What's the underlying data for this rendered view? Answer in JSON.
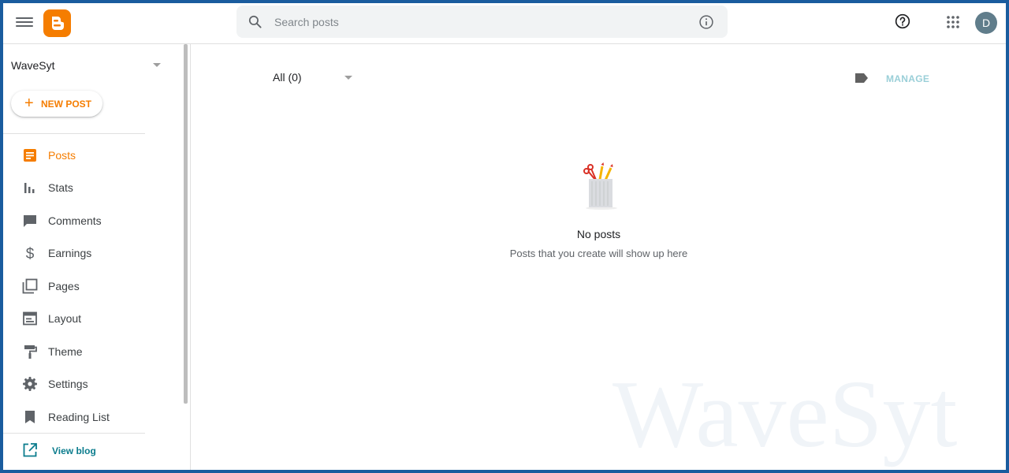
{
  "header": {
    "search_placeholder": "Search posts",
    "avatar_initial": "D"
  },
  "sidebar": {
    "blog_name": "WaveSyt",
    "new_post_label": "NEW POST",
    "items": [
      {
        "label": "Posts",
        "icon": "posts-icon",
        "active": true
      },
      {
        "label": "Stats",
        "icon": "stats-icon",
        "active": false
      },
      {
        "label": "Comments",
        "icon": "comments-icon",
        "active": false
      },
      {
        "label": "Earnings",
        "icon": "dollar-icon",
        "active": false
      },
      {
        "label": "Pages",
        "icon": "pages-icon",
        "active": false
      },
      {
        "label": "Layout",
        "icon": "layout-icon",
        "active": false
      },
      {
        "label": "Theme",
        "icon": "paint-roller-icon",
        "active": false
      },
      {
        "label": "Settings",
        "icon": "gear-icon",
        "active": false
      },
      {
        "label": "Reading List",
        "icon": "bookmark-icon",
        "active": false
      }
    ],
    "view_blog_label": "View blog"
  },
  "main": {
    "filter_label": "All (0)",
    "manage_label": "MANAGE",
    "empty_title": "No posts",
    "empty_subtitle": "Posts that you create will show up here"
  },
  "colors": {
    "accent": "#f57d00",
    "icon_gray": "#5f6368",
    "teal": "#0b7c8d",
    "manage": "#9acfd8"
  },
  "watermark_text": "WaveSyt"
}
